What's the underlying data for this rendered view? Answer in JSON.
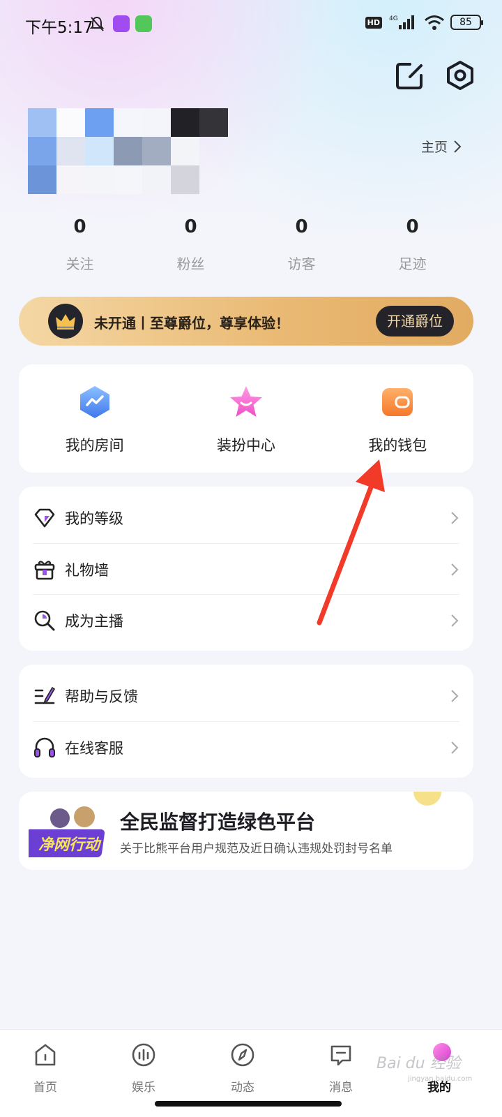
{
  "status_bar": {
    "time": "下午5:17",
    "hd": "HD",
    "network": "4G",
    "battery": "85"
  },
  "header": {
    "edit_icon": "edit-icon",
    "settings_icon": "gear-icon"
  },
  "profile": {
    "home_link": "主页"
  },
  "stats": [
    {
      "value": "0",
      "label": "关注"
    },
    {
      "value": "0",
      "label": "粉丝"
    },
    {
      "value": "0",
      "label": "访客"
    },
    {
      "value": "0",
      "label": "足迹"
    }
  ],
  "vip": {
    "text": "未开通丨至尊爵位，尊享体验！",
    "button": "开通爵位"
  },
  "quick_actions": [
    {
      "label": "我的房间",
      "icon": "room-icon",
      "color": "#4f8cf7"
    },
    {
      "label": "装扮中心",
      "icon": "star-icon",
      "color": "#f46ad0"
    },
    {
      "label": "我的钱包",
      "icon": "wallet-icon",
      "color": "#f7913e"
    }
  ],
  "menu_group_1": [
    {
      "label": "我的等级",
      "icon": "diamond-icon"
    },
    {
      "label": "礼物墙",
      "icon": "gift-icon"
    },
    {
      "label": "成为主播",
      "icon": "search-icon"
    }
  ],
  "menu_group_2": [
    {
      "label": "帮助与反馈",
      "icon": "feedback-icon"
    },
    {
      "label": "在线客服",
      "icon": "headset-icon"
    }
  ],
  "promo": {
    "title": "全民监督打造绿色平台",
    "subtitle": "关于比熊平台用户规范及近日确认违规处罚封号名单",
    "badge": "净网行动"
  },
  "tabs": [
    {
      "label": "首页",
      "icon": "home-icon"
    },
    {
      "label": "娱乐",
      "icon": "music-icon"
    },
    {
      "label": "动态",
      "icon": "compass-icon"
    },
    {
      "label": "消息",
      "icon": "message-icon"
    },
    {
      "label": "我的",
      "icon": "profile-icon",
      "active": true
    }
  ],
  "watermark": {
    "text": "Bai du 经验",
    "sub": "jingyan.baidu.com"
  }
}
